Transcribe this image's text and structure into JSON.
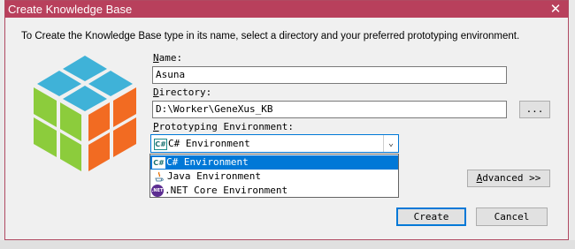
{
  "window": {
    "title": "Create Knowledge Base",
    "close_glyph": "✕"
  },
  "intro_text": "To Create the Knowledge Base type in its name, select a directory and your preferred prototyping environment.",
  "name_field": {
    "label_accel": "N",
    "label_rest": "ame:",
    "value": "Asuna"
  },
  "directory_field": {
    "label_accel": "D",
    "label_rest": "irectory:",
    "value": "D:\\Worker\\GeneXus_KB",
    "browse_label": "..."
  },
  "environment": {
    "label_accel": "P",
    "label_rest": "rototyping Environment:",
    "selected": "C# Environment",
    "selected_icon_text": "C#",
    "options": [
      {
        "label": "C# Environment",
        "icon": "csharp-icon",
        "icon_text": "C#"
      },
      {
        "label": "Java Environment",
        "icon": "java-icon",
        "icon_text": ""
      },
      {
        "label": ".NET Core Environment",
        "icon": "dotnet-icon",
        "icon_text": ".NET"
      }
    ]
  },
  "advanced_button": {
    "accel": "A",
    "rest": "dvanced >>"
  },
  "create_button": "Create",
  "cancel_button": "Cancel",
  "colors": {
    "titlebar": "#b8405c",
    "selection": "#0078d7",
    "cube_blue": "#3fb2d8",
    "cube_green": "#8ccc3c",
    "cube_orange": "#f26b22"
  }
}
